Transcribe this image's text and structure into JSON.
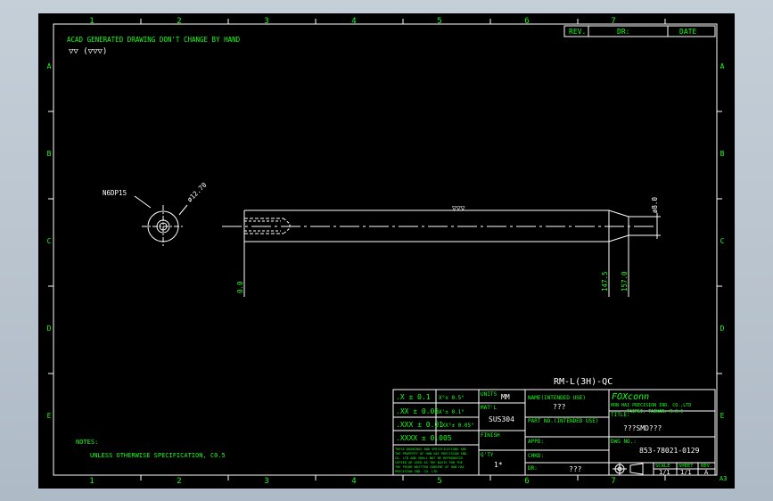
{
  "border": {
    "columns": [
      "1",
      "2",
      "3",
      "4",
      "5",
      "6",
      "7"
    ],
    "rows": [
      "A",
      "B",
      "C",
      "D",
      "E"
    ],
    "sheet_size": "A3"
  },
  "header": {
    "note": "ACAD GENERATED DRAWING  DON'T CHANGE BY HAND",
    "finish_symbol": "▽▽ (▽▽▽)",
    "rev_label": "REV.",
    "dr_label": "DR:",
    "date_label": "DATE"
  },
  "drawing": {
    "hole_label": "N6DP15",
    "dia_outer": "ø12.70",
    "dia_end": "ø8.0",
    "surface_symbol": "▽▽▽",
    "dim_zero": "0.0",
    "dim_147": "147.5",
    "dim_157": "157.0"
  },
  "part_name": "RM-L(3H)-QC",
  "tolerances": {
    "x1": ".X ± 0.1",
    "x2": ".XX ± 0.05",
    "x3": ".XXX ± 0.01",
    "x4": ".XXXX ± 0.005",
    "a1": "X°± 0.5°",
    "a2": "X'± 0.1°",
    "a3": ".XX°± 0.05°"
  },
  "fields": {
    "units_label": "UNITS",
    "units_value": "MM",
    "matl_label": "MAT'L",
    "matl_value": "SUS304",
    "finish_label": "FINISH",
    "qty_label": "Q'TY",
    "qty_value": "1*",
    "name_label": "NAME(INTENDED USE)",
    "name_value": "???",
    "partno_label": "PART NO.(INTENDED USE)",
    "title_label": "TITLE:",
    "title_value": "???SMD???",
    "appd_label": "APPD:",
    "chkd_label": "CHKD:",
    "dr_label": "DR:",
    "dr_value": "???",
    "dwgno_label": "DWG NO.:",
    "dwgno_value": "853-78021-0129",
    "scale_label": "SCALE",
    "scale_value": "1/1",
    "sheet_label": "SHEET",
    "sheet_value": "1/1",
    "rev_label": "REV.",
    "rev_value": "A"
  },
  "company": {
    "logo": "FOXconn",
    "name": "HON HAI PRECISION IND. CO.,LTD",
    "address": "TAIPEI, TAIWAN, R.O.C"
  },
  "disclaimer": [
    "THESE DRAWINGS AND SPECIFICATIONS ARE",
    "THE PROPERTY OF HON HAI PRECISION IND.",
    "CO. LTD AND SHALL NOT BE REPRODUCED",
    "COPIED OR USED AS THE BASIS FOR THE",
    "THE PRIOR WRITTEN CONSENT OF HON HAI",
    "PRECISION IND. CO. LTD"
  ],
  "notes": {
    "label": "NOTES:",
    "line1": "UNLESS OTHERWISE SPECIFICATION, C0.5"
  },
  "colors": {
    "line": "#ffffff",
    "text": "#1aff1a",
    "background": "#000000"
  }
}
